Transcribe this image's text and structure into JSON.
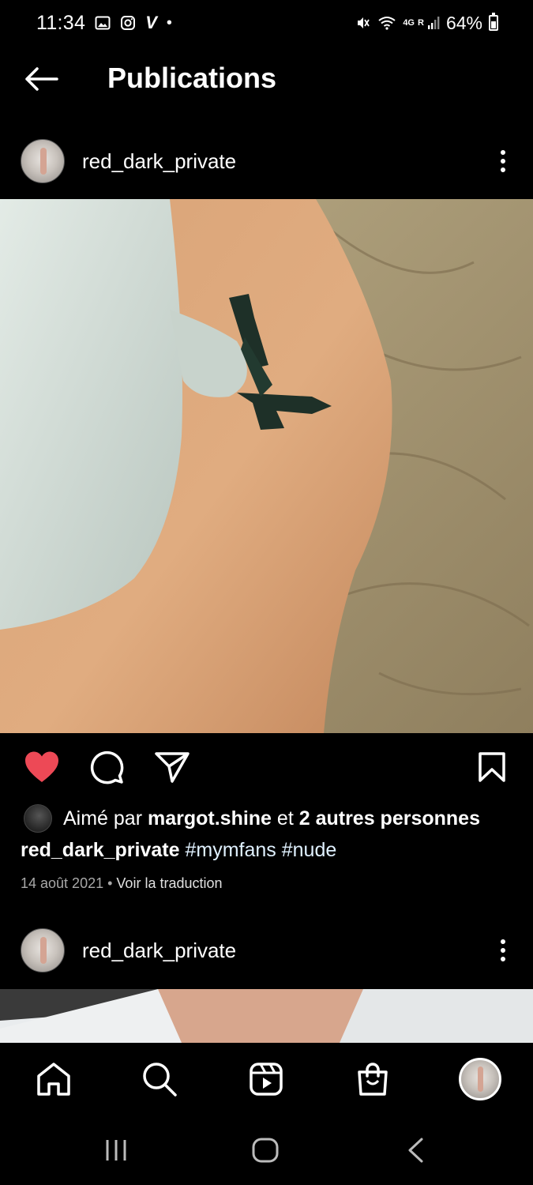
{
  "status_bar": {
    "time": "11:34",
    "dot": "•",
    "v_icon": "V",
    "network": "4G",
    "roaming": "R",
    "battery": "64%"
  },
  "header": {
    "title": "Publications"
  },
  "posts": [
    {
      "username": "red_dark_private",
      "liked_by_prefix": "Aimé par ",
      "liked_by_user": "margot.shine",
      "liked_by_mid": " et ",
      "liked_by_others": "2 autres personnes",
      "caption_user": "red_dark_private",
      "hashtags": [
        "#mymfans",
        "#nude"
      ],
      "date": "14 août 2021",
      "separator": " • ",
      "translate": "Voir la traduction",
      "liked": true
    },
    {
      "username": "red_dark_private"
    }
  ],
  "colors": {
    "background": "#000000",
    "like_red": "#ed4956",
    "meta_gray": "#a8a8a8"
  },
  "icons": {
    "back": "arrow-left-icon",
    "more": "more-vertical-icon",
    "like": "heart-filled-icon",
    "comment": "comment-icon",
    "share": "send-icon",
    "save": "bookmark-icon",
    "nav": [
      "home-icon",
      "search-icon",
      "reels-icon",
      "shop-icon",
      "profile-avatar"
    ],
    "system": [
      "recents-icon",
      "home-pill-icon",
      "back-chevron-icon"
    ]
  }
}
